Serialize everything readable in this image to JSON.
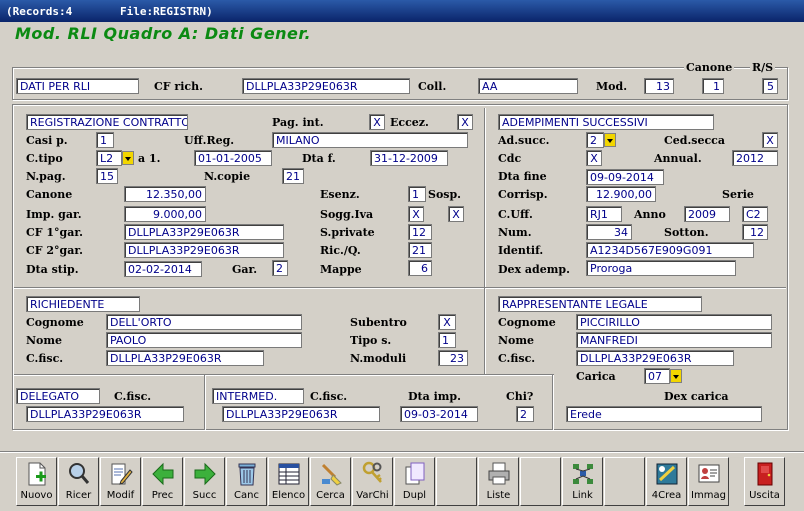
{
  "window": {
    "records": "(Records:4",
    "file": "File:REGISTRN)"
  },
  "title": "Mod. RLI Quadro A: Dati Gener.",
  "top": {
    "section": "DATI PER RLI",
    "cf_rich_label": "CF rich.",
    "cf_rich": "DLLPLA33P29E063R",
    "coll_label": "Coll.",
    "coll": "AA",
    "mod_label": "Mod.",
    "mod": "13",
    "canone_label": "Canone",
    "canone": "1",
    "rs_label": "R/S",
    "rs": "5"
  },
  "reg": {
    "section": "REGISTRAZIONE CONTRATTO",
    "pag_int_label": "Pag. int.",
    "pag_int": "X",
    "eccez_label": "Eccez.",
    "eccez": "X",
    "casi_label": "Casi p.",
    "casi": "1",
    "uff_reg_label": "Uff.Reg.",
    "uff_reg": "MILANO",
    "ctipo_label": "C.tipo",
    "ctipo": "L2",
    "a1_label": "a 1.",
    "a1": "01-01-2005",
    "dta_f_label": "Dta f.",
    "dta_f": "31-12-2009",
    "npag_label": "N.pag.",
    "npag": "15",
    "ncopie_label": "N.copie",
    "ncopie": "21",
    "canone_label": "Canone",
    "canone": "12.350,00",
    "esenz_label": "Esenz.",
    "esenz": "1",
    "sosp_label": "Sosp.",
    "imp_gar_label": "Imp. gar.",
    "imp_gar": "9.000,00",
    "sogg_iva_label": "Sogg.Iva",
    "sogg_iva": "X",
    "sosp": "X",
    "cf1_label": "CF 1°gar.",
    "cf1": "DLLPLA33P29E063R",
    "sprivate_label": "S.private",
    "sprivate": "12",
    "cf2_label": "CF 2°gar.",
    "cf2": "DLLPLA33P29E063R",
    "ricq_label": "Ric./Q.",
    "ricq": "21",
    "dta_stip_label": "Dta stip.",
    "dta_stip": "02-02-2014",
    "gar_label": "Gar.",
    "gar": "2",
    "mappe_label": "Mappe",
    "mappe": "6"
  },
  "adem": {
    "section": "ADEMPIMENTI SUCCESSIVI",
    "adsucc_label": "Ad.succ.",
    "adsucc": "2",
    "cedsecca_label": "Ced.secca",
    "cedsecca": "X",
    "cdc_label": "Cdc",
    "cdc": "X",
    "annual_label": "Annual.",
    "annual": "2012",
    "dtafine_label": "Dta fine",
    "dtafine": "09-09-2014",
    "corrisp_label": "Corrisp.",
    "corrisp": "12.900,00",
    "serie_label": "Serie",
    "cuff_label": "C.Uff.",
    "cuff": "RJ1",
    "anno_label": "Anno",
    "anno": "2009",
    "serie": "C2",
    "num_label": "Num.",
    "num": "34",
    "sotton_label": "Sotton.",
    "sotton": "12",
    "identif_label": "Identif.",
    "identif": "A1234D567E909G091",
    "dex_label": "Dex ademp.",
    "dex": "Proroga"
  },
  "rich": {
    "section": "RICHIEDENTE",
    "cognome_label": "Cognome",
    "cognome": "DELL'ORTO",
    "nome_label": "Nome",
    "nome": "PAOLO",
    "cfisc_label": "C.fisc.",
    "cfisc": "DLLPLA33P29E063R",
    "subentro_label": "Subentro",
    "subentro": "X",
    "tipos_label": "Tipo s.",
    "tipos": "1",
    "nmoduli_label": "N.moduli",
    "nmoduli": "23"
  },
  "rapp": {
    "section": "RAPPRESENTANTE LEGALE",
    "cognome_label": "Cognome",
    "cognome": "PICCIRILLO",
    "nome_label": "Nome",
    "nome": "MANFREDI",
    "cfisc_label": "C.fisc.",
    "cfisc": "DLLPLA33P29E063R",
    "carica_label": "Carica",
    "carica": "07",
    "dex_carica_label": "Dex carica",
    "dex_carica": "Erede"
  },
  "deleg": {
    "section": "DELEGATO",
    "cfisc_label": "C.fisc.",
    "cfisc": "DLLPLA33P29E063R"
  },
  "inter": {
    "section": "INTERMED.",
    "cfisc_label": "C.fisc.",
    "cfisc": "DLLPLA33P29E063R",
    "dta_imp_label": "Dta imp.",
    "dta_imp": "09-03-2014",
    "chi_label": "Chi?",
    "chi": "2"
  },
  "toolbar": [
    {
      "label": "Nuovo",
      "icon": "new-document-icon"
    },
    {
      "label": "Ricer",
      "icon": "magnifier-icon"
    },
    {
      "label": "Modif",
      "icon": "edit-document-icon"
    },
    {
      "label": "Prec",
      "icon": "arrow-left-icon"
    },
    {
      "label": "Succ",
      "icon": "arrow-right-icon"
    },
    {
      "label": "Canc",
      "icon": "trash-icon"
    },
    {
      "label": "Elenco",
      "icon": "list-icon"
    },
    {
      "label": "Cerca",
      "icon": "search-brush-icon"
    },
    {
      "label": "VarChi",
      "icon": "keys-icon"
    },
    {
      "label": "Dupl",
      "icon": "duplicate-icon"
    },
    {
      "label": "Liste",
      "icon": "printer-icon"
    },
    {
      "label": "Link",
      "icon": "network-icon"
    },
    {
      "label": "4Crea",
      "icon": "create-icon"
    },
    {
      "label": "Immag",
      "icon": "image-card-icon"
    },
    {
      "label": "Uscita",
      "icon": "exit-door-icon"
    }
  ]
}
